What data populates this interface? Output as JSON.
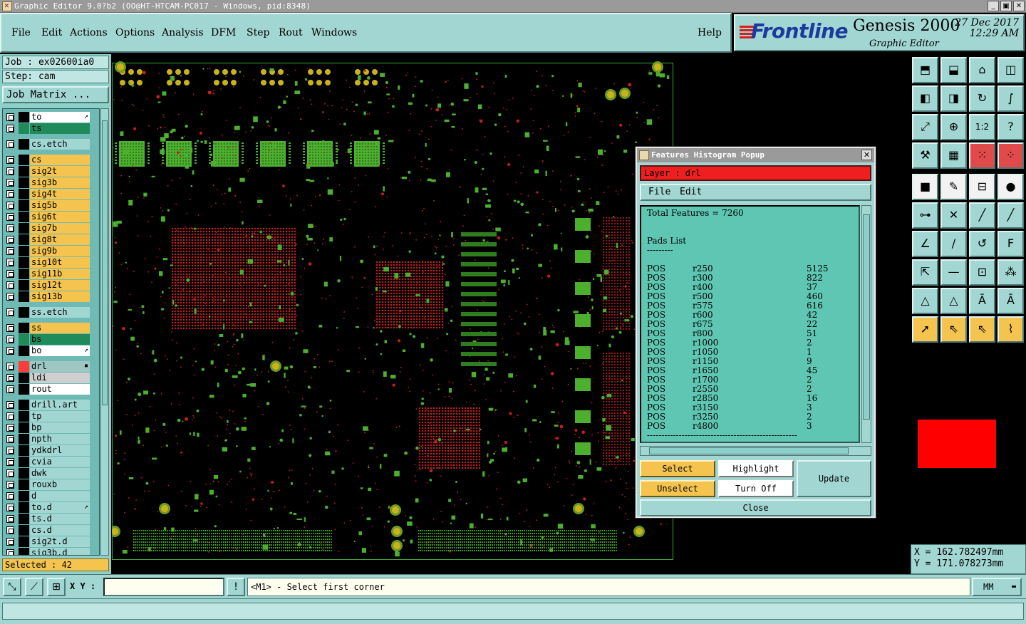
{
  "window": {
    "title": "Graphic Editor 9.0?b2 (OO@HT-HTCAM-PC017 - Windows, pid:8348)",
    "btn_minimize": "_",
    "btn_maximize": "▣",
    "btn_close": "✕"
  },
  "menu": {
    "items": [
      {
        "label": "File"
      },
      {
        "label": "Edit"
      },
      {
        "label": "Actions"
      },
      {
        "label": "Options"
      },
      {
        "label": "Analysis"
      },
      {
        "label": "DFM"
      },
      {
        "label": "Step"
      },
      {
        "label": "Rout"
      },
      {
        "label": "Windows"
      }
    ],
    "help": "Help"
  },
  "brand": {
    "logo": "Frontline",
    "product": "Genesis 2000",
    "subtitle": "Graphic Editor",
    "date": "27 Dec 2017",
    "time": "12:29 AM"
  },
  "job": {
    "job_label": "Job : ex02600ia0",
    "step_label": "Step: cam",
    "matrix_button": "Job Matrix ...",
    "selected": "Selected : 42"
  },
  "layers": [
    {
      "name": "to",
      "swatch": "#000000",
      "bg": "#ffffff",
      "mark": "↗"
    },
    {
      "name": "ts",
      "swatch": "#1f8a5a",
      "bg": "#1f8a5a"
    },
    {
      "name": "cs.etch",
      "swatch": "#000000",
      "bg": "#a2d6d2"
    },
    {
      "name": "cs",
      "swatch": "#000000",
      "bg": "#f4c44e"
    },
    {
      "name": "sig2t",
      "swatch": "#000000",
      "bg": "#f4c44e"
    },
    {
      "name": "sig3b",
      "swatch": "#000000",
      "bg": "#f4c44e"
    },
    {
      "name": "sig4t",
      "swatch": "#000000",
      "bg": "#f4c44e"
    },
    {
      "name": "sig5b",
      "swatch": "#000000",
      "bg": "#f4c44e"
    },
    {
      "name": "sig6t",
      "swatch": "#000000",
      "bg": "#f4c44e"
    },
    {
      "name": "sig7b",
      "swatch": "#000000",
      "bg": "#f4c44e"
    },
    {
      "name": "sig8t",
      "swatch": "#000000",
      "bg": "#f4c44e"
    },
    {
      "name": "sig9b",
      "swatch": "#000000",
      "bg": "#f4c44e"
    },
    {
      "name": "sig10t",
      "swatch": "#000000",
      "bg": "#f4c44e"
    },
    {
      "name": "sig11b",
      "swatch": "#000000",
      "bg": "#f4c44e"
    },
    {
      "name": "sig12t",
      "swatch": "#000000",
      "bg": "#f4c44e"
    },
    {
      "name": "sig13b",
      "swatch": "#000000",
      "bg": "#f4c44e"
    },
    {
      "name": "ss.etch",
      "swatch": "#000000",
      "bg": "#a2d6d2"
    },
    {
      "name": "ss",
      "swatch": "#000000",
      "bg": "#f4c44e"
    },
    {
      "name": "bs",
      "swatch": "#1f8a5a",
      "bg": "#1f8a5a"
    },
    {
      "name": "bo",
      "swatch": "#000000",
      "bg": "#ffffff",
      "mark": "↗"
    },
    {
      "name": "drl",
      "swatch": "#ff3b3b",
      "bg": "#9ec6c3",
      "mark": "▪"
    },
    {
      "name": "ldi",
      "swatch": "#000000",
      "bg": "#cfcfcf"
    },
    {
      "name": "rout",
      "swatch": "#000000",
      "bg": "#ffffff"
    },
    {
      "name": "drill.art",
      "swatch": "#000000",
      "bg": "#a2d6d2"
    },
    {
      "name": "tp",
      "swatch": "#000000",
      "bg": "#a2d6d2"
    },
    {
      "name": "bp",
      "swatch": "#000000",
      "bg": "#a2d6d2"
    },
    {
      "name": "npth",
      "swatch": "#000000",
      "bg": "#a2d6d2"
    },
    {
      "name": "ydkdrl",
      "swatch": "#000000",
      "bg": "#a2d6d2"
    },
    {
      "name": "cvia",
      "swatch": "#000000",
      "bg": "#a2d6d2"
    },
    {
      "name": "dwk",
      "swatch": "#000000",
      "bg": "#a2d6d2"
    },
    {
      "name": "rouxb",
      "swatch": "#000000",
      "bg": "#a2d6d2"
    },
    {
      "name": "d",
      "swatch": "#000000",
      "bg": "#a2d6d2"
    },
    {
      "name": "to.d",
      "swatch": "#000000",
      "bg": "#a2d6d2",
      "mark": "↗"
    },
    {
      "name": "ts.d",
      "swatch": "#000000",
      "bg": "#a2d6d2"
    },
    {
      "name": "cs.d",
      "swatch": "#000000",
      "bg": "#a2d6d2"
    },
    {
      "name": "sig2t.d",
      "swatch": "#000000",
      "bg": "#a2d6d2"
    },
    {
      "name": "sig3b.d",
      "swatch": "#000000",
      "bg": "#a2d6d2"
    }
  ],
  "popup": {
    "title": "Features Histogram Popup",
    "close_x": "✕",
    "layer_line": "Layer : drl",
    "menu_file": "File",
    "menu_edit": "Edit",
    "total": "Total Features = 7260",
    "section": "Pads List",
    "underline": "---------",
    "footer_line": "----------------------------------------------------",
    "rows": [
      {
        "pol": "POS",
        "sym": "r250",
        "count": "5125"
      },
      {
        "pol": "POS",
        "sym": "r300",
        "count": "822"
      },
      {
        "pol": "POS",
        "sym": "r400",
        "count": "37"
      },
      {
        "pol": "POS",
        "sym": "r500",
        "count": "460"
      },
      {
        "pol": "POS",
        "sym": "r575",
        "count": "616"
      },
      {
        "pol": "POS",
        "sym": "r600",
        "count": "42"
      },
      {
        "pol": "POS",
        "sym": "r675",
        "count": "22"
      },
      {
        "pol": "POS",
        "sym": "r800",
        "count": "51"
      },
      {
        "pol": "POS",
        "sym": "r1000",
        "count": "2"
      },
      {
        "pol": "POS",
        "sym": "r1050",
        "count": "1"
      },
      {
        "pol": "POS",
        "sym": "r1150",
        "count": "9"
      },
      {
        "pol": "POS",
        "sym": "r1650",
        "count": "45"
      },
      {
        "pol": "POS",
        "sym": "r1700",
        "count": "2"
      },
      {
        "pol": "POS",
        "sym": "r2550",
        "count": "2"
      },
      {
        "pol": "POS",
        "sym": "r2850",
        "count": "16"
      },
      {
        "pol": "POS",
        "sym": "r3150",
        "count": "3"
      },
      {
        "pol": "POS",
        "sym": "r3250",
        "count": "2"
      },
      {
        "pol": "POS",
        "sym": "r4800",
        "count": "3"
      }
    ],
    "btn_select": "Select",
    "btn_highlight": "Highlight",
    "btn_update": "Update",
    "btn_unselect": "Unselect",
    "btn_turnoff": "Turn Off",
    "btn_close": "Close"
  },
  "tools": [
    {
      "icon": "view-home-icon",
      "glyph": "⬒",
      "style": ""
    },
    {
      "icon": "view-down-icon",
      "glyph": "⬓",
      "style": ""
    },
    {
      "icon": "house-icon",
      "glyph": "⌂",
      "style": ""
    },
    {
      "icon": "split-view-icon",
      "glyph": "◫",
      "style": ""
    },
    {
      "icon": "pan-left-icon",
      "glyph": "◧",
      "style": ""
    },
    {
      "icon": "pan-right-icon",
      "glyph": "◨",
      "style": ""
    },
    {
      "icon": "mirror-icon",
      "glyph": "↻",
      "style": ""
    },
    {
      "icon": "snake-icon",
      "glyph": "∫",
      "style": ""
    },
    {
      "icon": "zoom-fit-icon",
      "glyph": "⤢",
      "style": ""
    },
    {
      "icon": "zoom-center-icon",
      "glyph": "⊕",
      "style": ""
    },
    {
      "icon": "scale-1-2-icon",
      "glyph": "1:2",
      "style": ""
    },
    {
      "icon": "help-icon",
      "glyph": "?",
      "style": ""
    },
    {
      "icon": "measure-icon",
      "glyph": "⚒",
      "style": ""
    },
    {
      "icon": "grid-icon",
      "glyph": "▦",
      "style": ""
    },
    {
      "icon": "layers-red-icon",
      "glyph": "⁙",
      "style": "red"
    },
    {
      "icon": "layers-red2-icon",
      "glyph": "⁘",
      "style": "red"
    },
    {
      "icon": "pad-icon",
      "glyph": "■",
      "style": "white"
    },
    {
      "icon": "pencil-shape-icon",
      "glyph": "✎",
      "style": "white"
    },
    {
      "icon": "ruler-icon",
      "glyph": "⊟",
      "style": "white"
    },
    {
      "icon": "dot-icon",
      "glyph": "●",
      "style": "white"
    },
    {
      "icon": "net-icon",
      "glyph": "⊶",
      "style": ""
    },
    {
      "icon": "cross-icon",
      "glyph": "✕",
      "style": ""
    },
    {
      "icon": "line-a-icon",
      "glyph": "╱",
      "style": ""
    },
    {
      "icon": "line-b-icon",
      "glyph": "╱",
      "style": ""
    },
    {
      "icon": "angle-icon",
      "glyph": "∠",
      "style": ""
    },
    {
      "icon": "slash-icon",
      "glyph": "/",
      "style": ""
    },
    {
      "icon": "arc-icon",
      "glyph": "↺",
      "style": ""
    },
    {
      "icon": "text-f-icon",
      "glyph": "F",
      "style": ""
    },
    {
      "icon": "move-icon",
      "glyph": "⇱",
      "style": ""
    },
    {
      "icon": "minus-icon",
      "glyph": "—",
      "style": ""
    },
    {
      "icon": "bracket-icon",
      "glyph": "⊡",
      "style": ""
    },
    {
      "icon": "shapes-icon",
      "glyph": "⁂",
      "style": ""
    },
    {
      "icon": "tri-a-icon",
      "glyph": "△",
      "style": ""
    },
    {
      "icon": "tri-b-icon",
      "glyph": "△",
      "style": ""
    },
    {
      "icon": "tri-c-icon",
      "glyph": "Ā",
      "style": ""
    },
    {
      "icon": "tri-d-icon",
      "glyph": "Ā",
      "style": ""
    },
    {
      "icon": "pointer-icon",
      "glyph": "➚",
      "style": "org"
    },
    {
      "icon": "pointer-box-icon",
      "glyph": "⇖",
      "style": "org"
    },
    {
      "icon": "pointer-select-icon",
      "glyph": "⇖",
      "style": "org"
    },
    {
      "icon": "route-icon",
      "glyph": "⌇",
      "style": "org"
    }
  ],
  "coords": {
    "x": "X = 162.782497mm",
    "y": "Y = 171.078273mm"
  },
  "bottom": {
    "xy_label": "X Y :",
    "xy_value": "",
    "info_glyph": "!",
    "prompt": "<M1> - Select first corner",
    "units": "MM"
  }
}
